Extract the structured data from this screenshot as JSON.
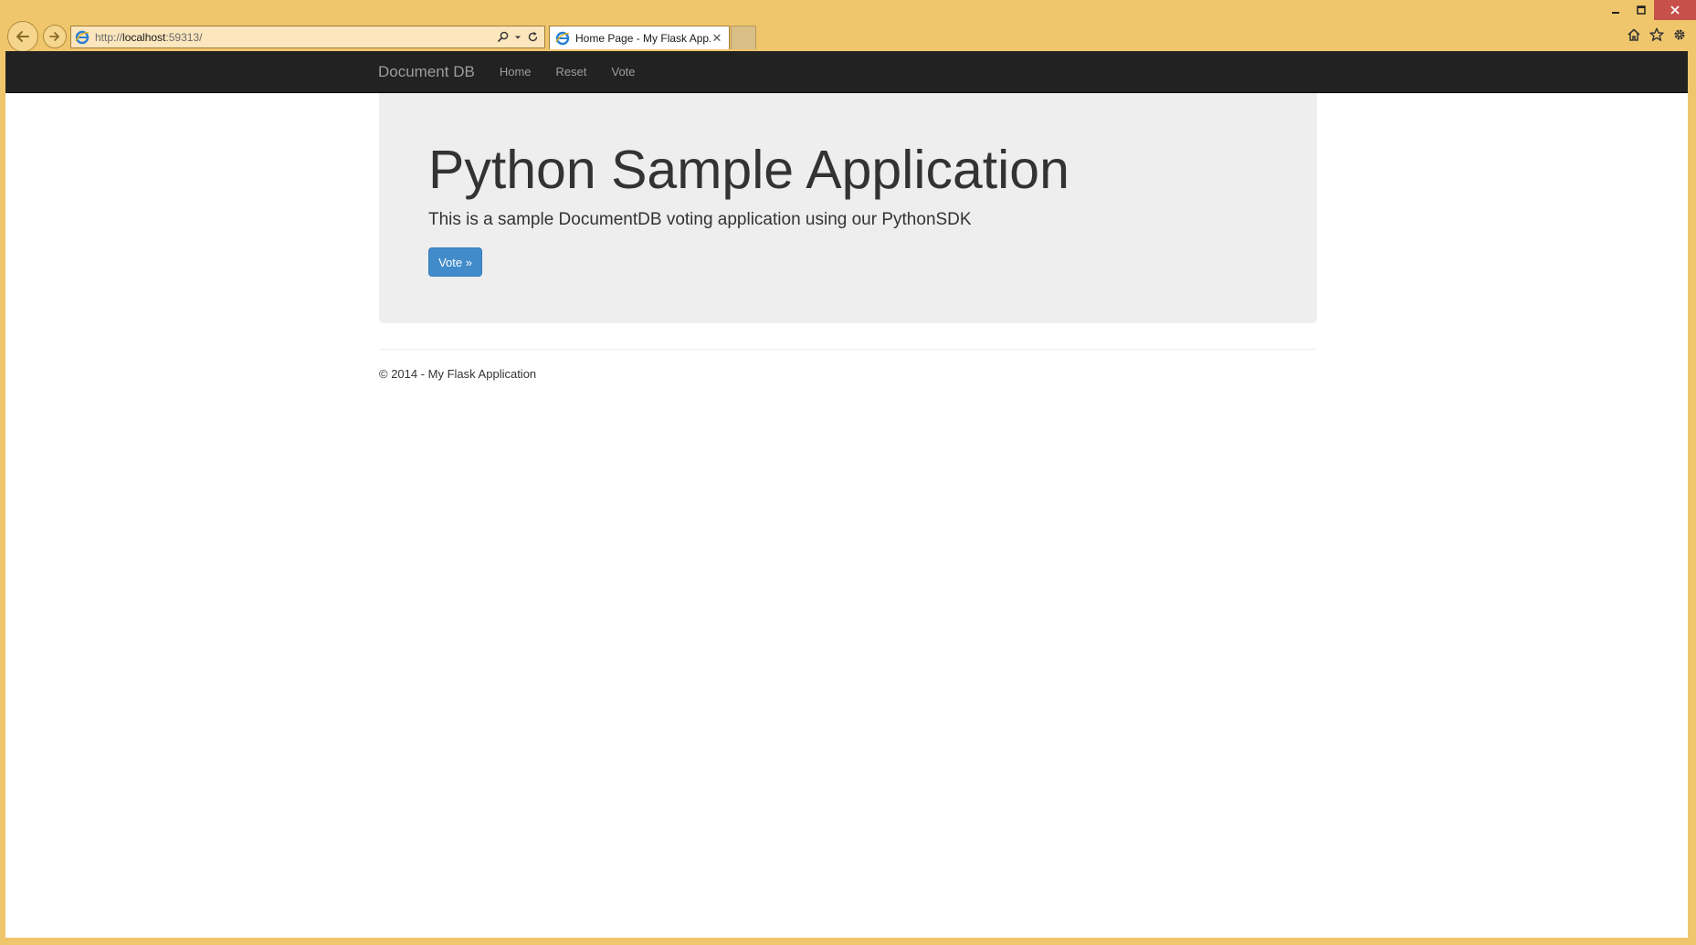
{
  "browser": {
    "address_bar": {
      "url_scheme": "http://",
      "url_host": "localhost",
      "url_rest": ":59313/"
    },
    "tab": {
      "title": "Home Page - My Flask App...",
      "close_glyph": "✕"
    },
    "icons": {
      "back": "back-arrow-icon",
      "forward": "forward-arrow-icon",
      "search": "search-icon",
      "dropdown": "chevron-down-icon",
      "refresh": "refresh-icon",
      "home": "home-icon",
      "favorites": "star-icon",
      "tools": "gear-icon",
      "favicon": "ie-favicon-icon"
    }
  },
  "navbar": {
    "brand": "Document DB",
    "links": [
      "Home",
      "Reset",
      "Vote"
    ]
  },
  "jumbotron": {
    "title": "Python Sample Application",
    "lead": "This is a sample DocumentDB voting application using our PythonSDK",
    "button_label": "Vote »"
  },
  "footer": {
    "text": "© 2014 - My Flask Application"
  },
  "colors": {
    "frame": "#f0c66c",
    "navbar_bg": "#222222",
    "navbar_text": "#9d9d9d",
    "jumbotron_bg": "#eeeeee",
    "primary_button": "#428bca",
    "close_button": "#c7504a"
  }
}
